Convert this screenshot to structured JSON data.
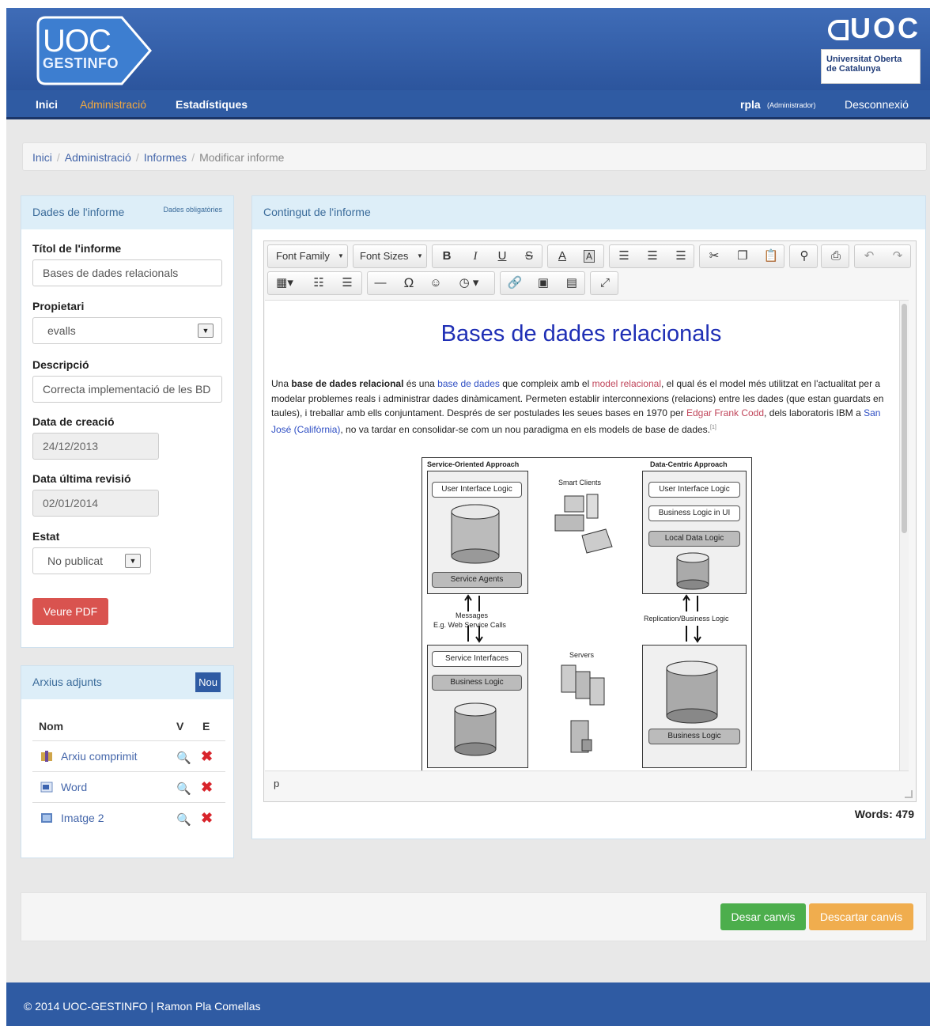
{
  "header": {
    "logo_line1": "UOC",
    "logo_line2": "GESTINFO",
    "brand_mark": "UOC",
    "brand_line1": "Universitat Oberta",
    "brand_line2": "de Catalunya"
  },
  "nav": {
    "items": [
      {
        "label": "Inici"
      },
      {
        "label": "Administració"
      },
      {
        "label": "Estadístiques"
      }
    ],
    "user": "rpla",
    "user_role": "(Administrador)",
    "logout": "Desconnexió"
  },
  "breadcrumb": [
    "Inici",
    "Administració",
    "Informes",
    "Modificar informe"
  ],
  "form_panel": {
    "title": "Dades de l'informe",
    "required_note": "Dades obligatòries",
    "title_label": "Títol de l'informe",
    "title_value": "Bases de dades relacionals",
    "owner_label": "Propietari",
    "owner_value": "evalls",
    "desc_label": "Descripció",
    "desc_value": "Correcta implementació de les BD",
    "created_label": "Data de creació",
    "created_value": "24/12/2013",
    "revised_label": "Data última revisió",
    "revised_value": "02/01/2014",
    "state_label": "Estat",
    "state_value": "No publicat",
    "pdf_button": "Veure PDF"
  },
  "attachments": {
    "title": "Arxius adjunts",
    "new_button": "Nou",
    "col_name": "Nom",
    "col_v": "V",
    "col_e": "E",
    "files": [
      {
        "name": "Arxiu comprimit",
        "icon": "archive-icon"
      },
      {
        "name": "Word",
        "icon": "word-icon"
      },
      {
        "name": "Imatge 2",
        "icon": "image-icon"
      }
    ]
  },
  "editor": {
    "panel_title": "Contingut de l'informe",
    "font_family": "Font Family",
    "font_sizes": "Font Sizes",
    "doc_title": "Bases de dades relacionals",
    "para": {
      "t1": "Una ",
      "b1": "base de dades relacional",
      "t2": " és una ",
      "l1": "base de dades",
      "t3": " que compleix amb el ",
      "l2": "model relacional",
      "t4": ", el qual és el model més utilitzat en l'actualitat per a modelar problemes reals i administrar dades dinàmicament. Permeten establir interconnexions (relacions) entre les dades (que estan guardats en taules), i treballar amb ells conjuntament. Després de ser postulades les seues bases en 1970 per ",
      "l3": "Edgar Frank Codd",
      "t5": ", dels laboratoris IBM a ",
      "l4": "San José (Califòrnia)",
      "t6": ", no va tardar en consolidar-se com un nou paradigma en els models de base de dades.",
      "sup": "[1]"
    },
    "diagram": {
      "left_title": "Service-Oriented Approach",
      "right_title": "Data-Centric Approach",
      "ui_logic_left": "User Interface Logic",
      "service_agents": "Service Agents",
      "smart_clients": "Smart Clients",
      "ui_logic_right": "User Interface Logic",
      "bl_in_ui": "Business Logic in UI",
      "local_data": "Local Data Logic",
      "messages": "Messages",
      "ws_calls": "E.g. Web Service Calls",
      "replication": "Replication/Business Logic",
      "service_interfaces": "Service Interfaces",
      "business_logic_left": "Business Logic",
      "servers": "Servers",
      "business_logic_right": "Business Logic"
    },
    "status_path": "p",
    "word_count": "Words: 479"
  },
  "actions": {
    "save": "Desar canvis",
    "discard": "Descartar canvis"
  },
  "footer": {
    "text": "© 2014 UOC-GESTINFO | Ramon Pla Comellas"
  },
  "colors": {
    "header_blue": "#2f5ba3",
    "accent_orange": "#f0a841",
    "pdf_red": "#d9534f",
    "save_green": "#4cae4c",
    "discard_orange": "#f0ad4e"
  }
}
